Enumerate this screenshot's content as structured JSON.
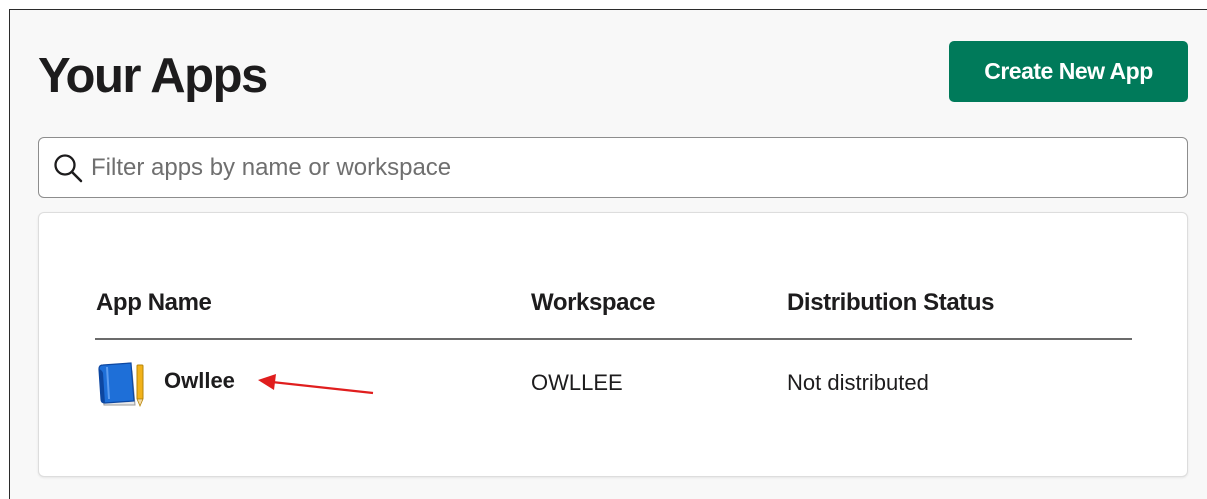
{
  "page": {
    "title": "Your Apps",
    "create_button_label": "Create New App"
  },
  "search": {
    "placeholder": "Filter apps by name or workspace",
    "value": ""
  },
  "table": {
    "columns": [
      "App Name",
      "Workspace",
      "Distribution Status"
    ],
    "rows": [
      {
        "app_name": "Owllee",
        "icon": "book-icon",
        "workspace": "OWLLEE",
        "distribution_status": "Not distributed"
      }
    ]
  },
  "colors": {
    "primary_button": "#007a5a",
    "annotation_arrow": "#e01e1e"
  }
}
